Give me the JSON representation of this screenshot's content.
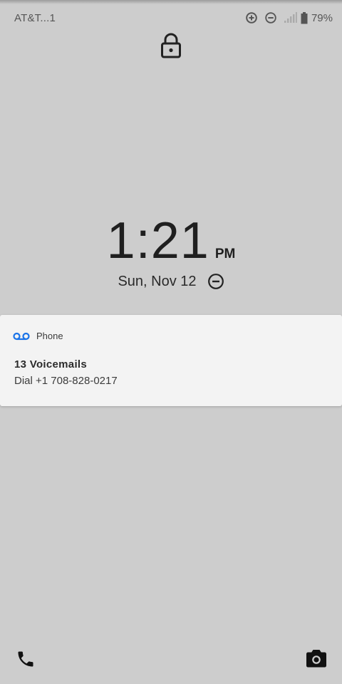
{
  "status_bar": {
    "carrier": "AT&T...1",
    "battery_percent": "79%",
    "icons": [
      "data-saver-icon",
      "do-not-disturb-icon",
      "signal-icon",
      "battery-icon"
    ]
  },
  "lock_screen": {
    "lock_icon": "lock-icon",
    "time": "1:21",
    "ampm": "PM",
    "date": "Sun, Nov 12",
    "date_icon": "do-not-disturb-icon"
  },
  "notification": {
    "app_icon": "voicemail-icon",
    "app_name": "Phone",
    "title": "13 Voicemails",
    "text": "Dial +1 708-828-0217",
    "accent_color": "#1a73e8"
  },
  "shortcuts": {
    "left": "phone-icon",
    "right": "camera-icon"
  }
}
